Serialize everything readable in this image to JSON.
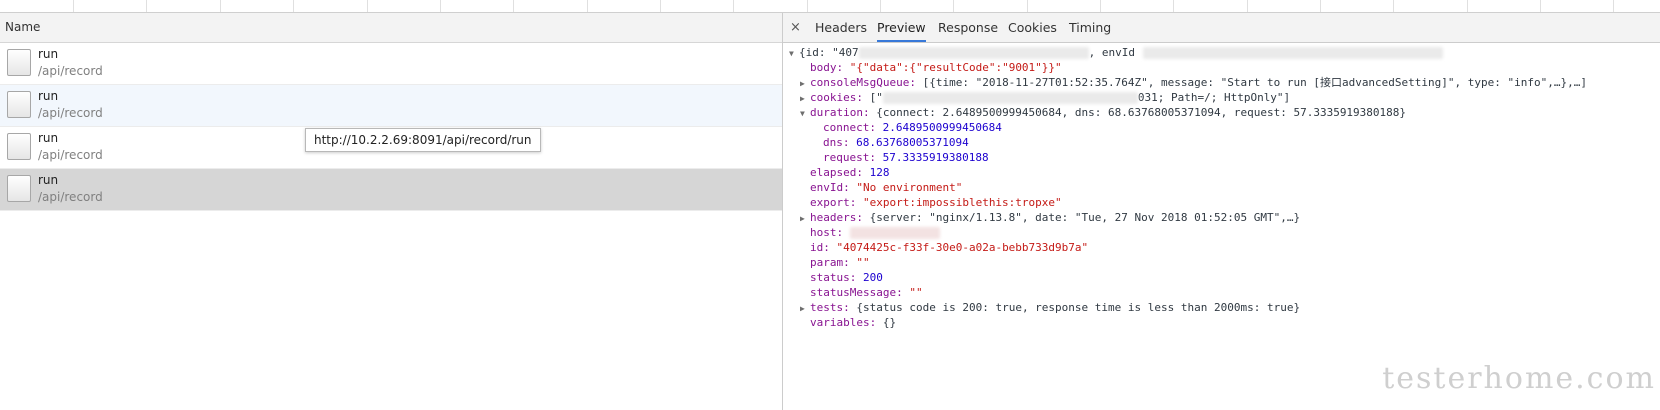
{
  "left_pane": {
    "column_header": "Name",
    "requests": [
      {
        "name": "run",
        "path": "/api/record"
      },
      {
        "name": "run",
        "path": "/api/record"
      },
      {
        "name": "run",
        "path": "/api/record"
      },
      {
        "name": "run",
        "path": "/api/record"
      }
    ],
    "tooltip": "http://10.2.2.69:8091/api/record/run"
  },
  "tabs": {
    "close_glyph": "×",
    "items": [
      "Headers",
      "Preview",
      "Response",
      "Cookies",
      "Timing"
    ],
    "active": "Preview"
  },
  "preview": {
    "root_open": "{id: \"407",
    "root_envid_key": ", envId",
    "body_key": "body:",
    "body_value": "\"{\"data\":{\"resultCode\":\"9001\"}}\"",
    "console_key": "consoleMsgQueue:",
    "console_value": "[{time: \"2018-11-27T01:52:35.764Z\", message: \"Start to run [接口advancedSetting]\", type: \"info\",…},…]",
    "cookies_key": "cookies:",
    "cookies_prefix": "[\"",
    "cookies_suffix": "031; Path=/; HttpOnly\"]",
    "duration_key": "duration:",
    "duration_value": "{connect: 2.6489500999450684, dns: 68.63768005371094, request: 57.3335919380188}",
    "connect_key": "connect:",
    "connect_value": "2.6489500999450684",
    "dns_key": "dns:",
    "dns_value": "68.63768005371094",
    "request_key": "request:",
    "request_value": "57.3335919380188",
    "elapsed_key": "elapsed:",
    "elapsed_value": "128",
    "envid_key": "envId:",
    "envid_value": "\"No environment\"",
    "export_key": "export:",
    "export_value": "\"export:impossiblethis:tropxe\"",
    "headers_key": "headers:",
    "headers_value": "{server: \"nginx/1.13.8\", date: \"Tue, 27 Nov 2018 01:52:05 GMT\",…}",
    "host_key": "host:",
    "id_key": "id:",
    "id_value": "\"4074425c-f33f-30e0-a02a-bebb733d9b7a\"",
    "param_key": "param:",
    "param_value": "\"\"",
    "status_key": "status:",
    "status_value": "200",
    "statusmessage_key": "statusMessage:",
    "statusmessage_value": "\"\"",
    "tests_key": "tests:",
    "tests_value": "{status code is 200: true, response time is less than 2000ms: true}",
    "variables_key": "variables:",
    "variables_value": "{}"
  },
  "watermark": "testerhome.com",
  "icons": {
    "expand": "triangle-right-icon",
    "collapse": "triangle-down-icon",
    "file": "document-icon"
  }
}
